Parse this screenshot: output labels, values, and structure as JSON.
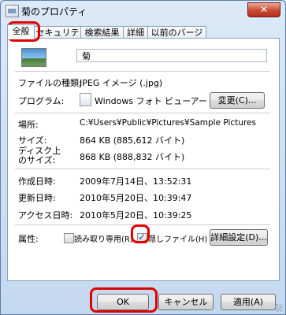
{
  "window": {
    "title": "菊のプロパティ",
    "close_label": "✕"
  },
  "tabs": [
    {
      "label": "全般"
    },
    {
      "label": "セキュリティ"
    },
    {
      "label": "検索結果"
    },
    {
      "label": "詳細"
    },
    {
      "label": "以前のバージョン"
    }
  ],
  "file": {
    "name": "菊"
  },
  "properties": {
    "type_label": "ファイルの種類:",
    "type_value": "JPEG イメージ (.jpg)",
    "program_label": "プログラム:",
    "program_value": "Windows フォト ビューアー",
    "change_button": "変更(C)...",
    "location_label": "場所:",
    "location_value": "C:¥Users¥Public¥Pictures¥Sample Pictures",
    "size_label": "サイズ:",
    "size_value": "864 KB (885,612 バイト)",
    "disk_size_label_1": "ディスク上",
    "disk_size_label_2": "のサイズ:",
    "disk_size_value": "868 KB (888,832 バイト)",
    "created_label": "作成日時:",
    "created_value": "2009年7月14日、13:52:31",
    "modified_label": "更新日時:",
    "modified_value": "2010年5月20日、10:39:47",
    "accessed_label": "アクセス日時:",
    "accessed_value": "2010年5月20日、10:39:25"
  },
  "attributes": {
    "label": "属性:",
    "readonly_label": "読み取り専用(R)",
    "readonly_checked": false,
    "hidden_label": "隠しファイル(H)",
    "hidden_checked": true,
    "advanced_button": "詳細設定(D)..."
  },
  "footer": {
    "ok_button": "OK",
    "cancel_button": "キャンセル",
    "apply_button": "適用(A)"
  },
  "colors": {
    "annotation": "#e00000",
    "close_button": "#c84a32"
  }
}
